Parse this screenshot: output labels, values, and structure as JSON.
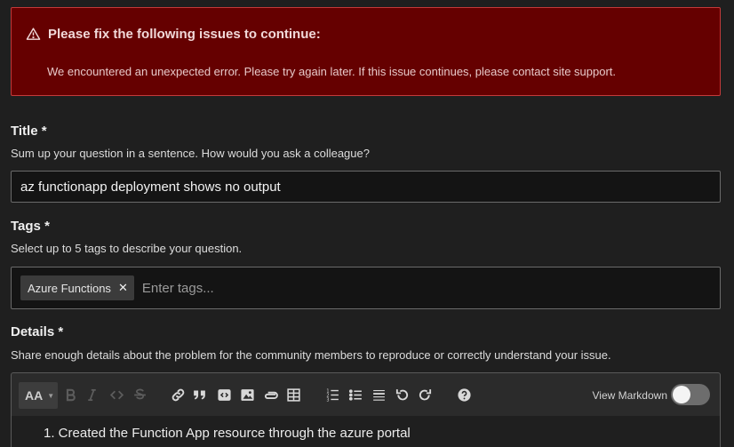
{
  "alert": {
    "title": "Please fix the following issues to continue:",
    "message": "We encountered an unexpected error. Please try again later. If this issue continues, please contact site support."
  },
  "title_section": {
    "label": "Title *",
    "help": "Sum up your question in a sentence. How would you ask a colleague?",
    "value": "az functionapp deployment shows no output"
  },
  "tags_section": {
    "label": "Tags *",
    "help": "Select up to 5 tags to describe your question.",
    "tags": [
      "Azure Functions"
    ],
    "remove_glyph": "✕",
    "placeholder": "Enter tags..."
  },
  "details_section": {
    "label": "Details *",
    "help": "Share enough details about the problem for the community members to reproduce or correctly understand your issue."
  },
  "editor": {
    "font_size_label": "AA",
    "view_markdown_label": "View Markdown",
    "view_markdown_on": false,
    "content_line": "1. Created the Function App resource through the azure portal",
    "toolbar_icons": [
      "font-size-icon",
      "bold-icon",
      "italic-icon",
      "code-icon",
      "strikethrough-icon",
      "link-icon",
      "quote-icon",
      "code-block-icon",
      "image-icon",
      "attachment-icon",
      "table-icon",
      "numbered-list-icon",
      "bulleted-list-icon",
      "horizontal-rule-icon",
      "undo-icon",
      "redo-icon",
      "help-icon"
    ]
  },
  "colors": {
    "background": "#1f1f1f",
    "alert_bg": "#650000",
    "alert_border": "#c43a3a"
  }
}
